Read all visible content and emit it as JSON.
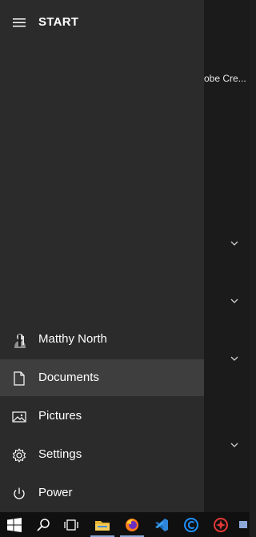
{
  "start": {
    "title": "START"
  },
  "background": {
    "partial_text": "obe Cre..."
  },
  "rail": {
    "user": {
      "label": "Matthy North"
    },
    "documents": {
      "label": "Documents"
    },
    "pictures": {
      "label": "Pictures"
    },
    "settings": {
      "label": "Settings"
    },
    "power": {
      "label": "Power"
    }
  },
  "taskbar": {
    "items": [
      "windows-start",
      "search",
      "task-view",
      "file-explorer",
      "firefox",
      "visual-studio-code",
      "app-c",
      "app-red"
    ],
    "indicator_color": "#8aa7d8"
  }
}
